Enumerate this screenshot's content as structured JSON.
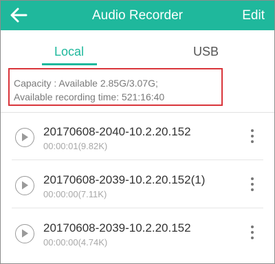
{
  "header": {
    "title": "Audio Recorder",
    "edit_label": "Edit",
    "back_icon": "arrow-left-icon"
  },
  "tabs": [
    {
      "label": "Local",
      "active": true
    },
    {
      "label": "USB",
      "active": false
    }
  ],
  "storage": {
    "capacity": "Capacity : Available 2.85G/3.07G;",
    "recording_time": "Available recording time: 521:16:40"
  },
  "recordings": [
    {
      "name": "20170608-2040-10.2.20.152",
      "meta": "00:00:01(9.82K)"
    },
    {
      "name": "20170608-2039-10.2.20.152(1)",
      "meta": "00:00:00(7.11K)"
    },
    {
      "name": "20170608-2039-10.2.20.152",
      "meta": "00:00:00(4.74K)"
    }
  ],
  "colors": {
    "accent": "#1fb89c",
    "highlight_border": "#d9343a"
  }
}
